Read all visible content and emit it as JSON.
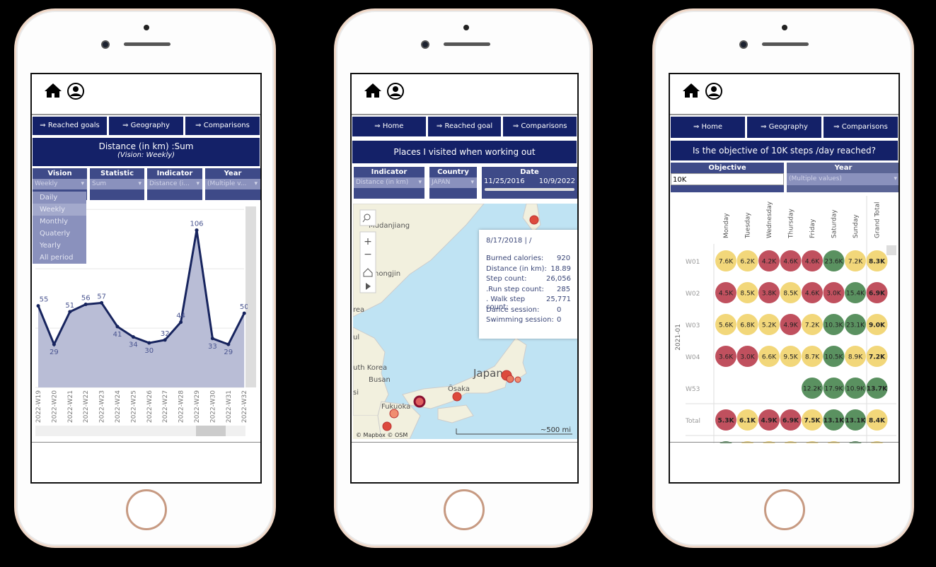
{
  "colors": {
    "navy": "#142168",
    "filter": "#3e4a88",
    "dropdown": "#8a91bd",
    "red": "#c0505e",
    "yellow": "#f2d77a",
    "green": "#5a9160"
  },
  "icons": {
    "home": "home-icon",
    "user": "user-icon"
  },
  "phone1": {
    "nav": [
      "⇒ Reached goals",
      "⇒ Geography",
      "⇒ Comparisons"
    ],
    "title": "Distance (in km) :Sum",
    "subtitle": "(Vision: Weekly)",
    "filters": [
      {
        "label": "Vision",
        "value": "Weekly"
      },
      {
        "label": "Statistic",
        "value": "Sum"
      },
      {
        "label": "Indicator",
        "value": "Distance (i..."
      },
      {
        "label": "Year",
        "value": "(Multiple v..."
      }
    ],
    "vision_options": [
      "Daily",
      "Weekly",
      "Monthly",
      "Quaterly",
      "Yearly",
      "All period"
    ],
    "selected_option": "Weekly"
  },
  "chart_data": {
    "type": "area",
    "x": [
      "2022-W19",
      "2022-W20",
      "2022-W21",
      "2022-W22",
      "2022-W23",
      "2022-W24",
      "2022-W25",
      "2022-W26",
      "2022-W27",
      "2022-W28",
      "2022-W29",
      "2022-W30",
      "2022-W31",
      "2022-W32"
    ],
    "values": [
      55,
      29,
      51,
      56,
      57,
      41,
      34,
      30,
      32,
      44,
      106,
      33,
      29,
      50
    ],
    "ylim": [
      0,
      122
    ],
    "grid": true
  },
  "phone2": {
    "nav": [
      "⇒ Home",
      "⇒ Reached goal",
      "⇒ Comparisons"
    ],
    "title": "Places I visited when working out",
    "filters": [
      {
        "label": "Indicator",
        "value": "Distance (in km)"
      },
      {
        "label": "Country",
        "value": "JAPAN"
      }
    ],
    "date": {
      "label": "Date",
      "start": "11/25/2016",
      "end": "10/9/2022"
    },
    "map_labels": [
      "Mudanjiang",
      "hongjin",
      "rea",
      "ul",
      "uth Korea",
      "Busan",
      "si",
      "Japan",
      "Ōsaka",
      "Fukuoka"
    ],
    "attribution": "© Mapbox  © OSM",
    "scale": "~500 mi",
    "tooltip": {
      "title": "8/17/2018 |  /",
      "rows": [
        [
          "Burned calories:",
          "920"
        ],
        [
          "Distance (in km):",
          "18.89"
        ],
        [
          "Step count:",
          "26,056"
        ],
        [
          ".Run step count:",
          "285"
        ],
        [
          ". Walk step count:",
          "25,771"
        ],
        [
          "Dance session:",
          "0"
        ],
        [
          "Swimming session:",
          "0"
        ]
      ]
    }
  },
  "phone3": {
    "nav": [
      "⇒ Home",
      "⇒ Geography",
      "⇒ Comparisons"
    ],
    "title": "Is the objective of 10K steps /day reached?",
    "objective": {
      "label": "Objective",
      "value": "10K"
    },
    "year": {
      "label": "Year",
      "value": "(Multiple values)"
    },
    "group": "2021-01",
    "columns": [
      "Monday",
      "Tuesday",
      "Wednesday",
      "Thursday",
      "Friday",
      "Saturday",
      "Sunday",
      "Grand Total"
    ],
    "rows": [
      {
        "label": "W01",
        "cells": [
          [
            "7.6K",
            "y"
          ],
          [
            "6.2K",
            "y"
          ],
          [
            "4.2K",
            "r"
          ],
          [
            "4.6K",
            "r"
          ],
          [
            "4.6K",
            "r"
          ],
          [
            "23.6K",
            "g"
          ],
          [
            "7.2K",
            "y"
          ],
          [
            "8.3K",
            "y"
          ]
        ]
      },
      {
        "label": "W02",
        "cells": [
          [
            "4.5K",
            "r"
          ],
          [
            "8.5K",
            "y"
          ],
          [
            "3.8K",
            "r"
          ],
          [
            "8.5K",
            "y"
          ],
          [
            "4.6K",
            "r"
          ],
          [
            "3.0K",
            "r"
          ],
          [
            "15.4K",
            "g"
          ],
          [
            "6.9K",
            "r"
          ]
        ]
      },
      {
        "label": "W03",
        "cells": [
          [
            "5.6K",
            "y"
          ],
          [
            "6.8K",
            "y"
          ],
          [
            "5.2K",
            "y"
          ],
          [
            "4.9K",
            "r"
          ],
          [
            "7.2K",
            "y"
          ],
          [
            "10.3K",
            "g"
          ],
          [
            "23.1K",
            "g"
          ],
          [
            "9.0K",
            "y"
          ]
        ]
      },
      {
        "label": "W04",
        "cells": [
          [
            "3.6K",
            "r"
          ],
          [
            "3.0K",
            "r"
          ],
          [
            "6.6K",
            "y"
          ],
          [
            "9.5K",
            "y"
          ],
          [
            "8.7K",
            "y"
          ],
          [
            "10.5K",
            "g"
          ],
          [
            "8.9K",
            "y"
          ],
          [
            "7.2K",
            "y"
          ]
        ]
      },
      {
        "label": "W53",
        "cells": [
          null,
          null,
          null,
          null,
          [
            "12.2K",
            "g"
          ],
          [
            "17.9K",
            "g"
          ],
          [
            "10.9K",
            "g"
          ],
          [
            "13.7K",
            "g"
          ]
        ]
      },
      {
        "label": "Total",
        "cells": [
          [
            "5.3K",
            "r"
          ],
          [
            "6.1K",
            "y"
          ],
          [
            "4.9K",
            "r"
          ],
          [
            "6.9K",
            "r"
          ],
          [
            "7.5K",
            "y"
          ],
          [
            "13.1K",
            "g"
          ],
          [
            "13.1K",
            "g"
          ],
          [
            "8.4K",
            "y"
          ]
        ]
      }
    ]
  }
}
